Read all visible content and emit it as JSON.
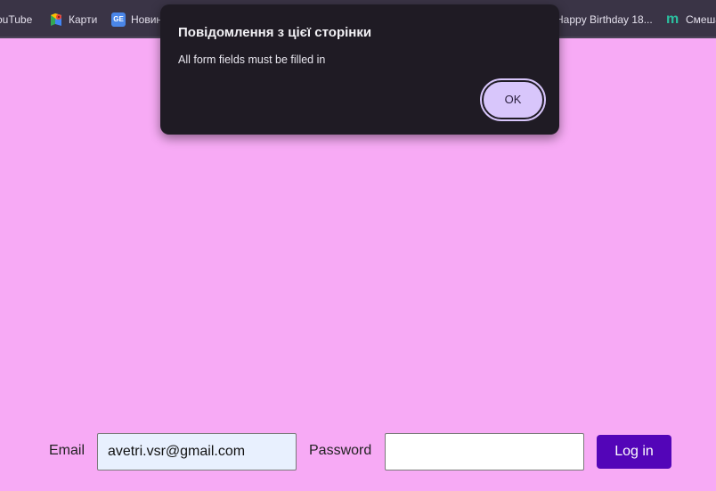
{
  "bookmarks": {
    "items": [
      {
        "label": "ouTube",
        "icon": "youtube-icon"
      },
      {
        "label": "Карти",
        "icon": "maps-icon"
      },
      {
        "label": "Новин",
        "icon": "news-icon"
      },
      {
        "label": "Happy Birthday 18...",
        "icon": "none"
      },
      {
        "label": "Смеша",
        "icon": "m-logo-icon"
      }
    ],
    "news_icon_text": "GE",
    "m_icon_text": "m"
  },
  "dialog": {
    "title": "Повідомлення з цієї сторінки",
    "message": "All form fields must be filled in",
    "ok_label": "OK"
  },
  "form": {
    "email_label": "Email",
    "email_value": "avetri.vsr@gmail.com",
    "password_label": "Password",
    "password_value": "",
    "login_label": "Log in"
  },
  "colors": {
    "page_background": "#f7aaf5",
    "bookmarks_bar": "#3a3446",
    "dialog_background": "#1f1b24",
    "ok_button": "#d8c6fb",
    "login_button": "#5305b8",
    "email_autofill": "#e8f0fe"
  }
}
